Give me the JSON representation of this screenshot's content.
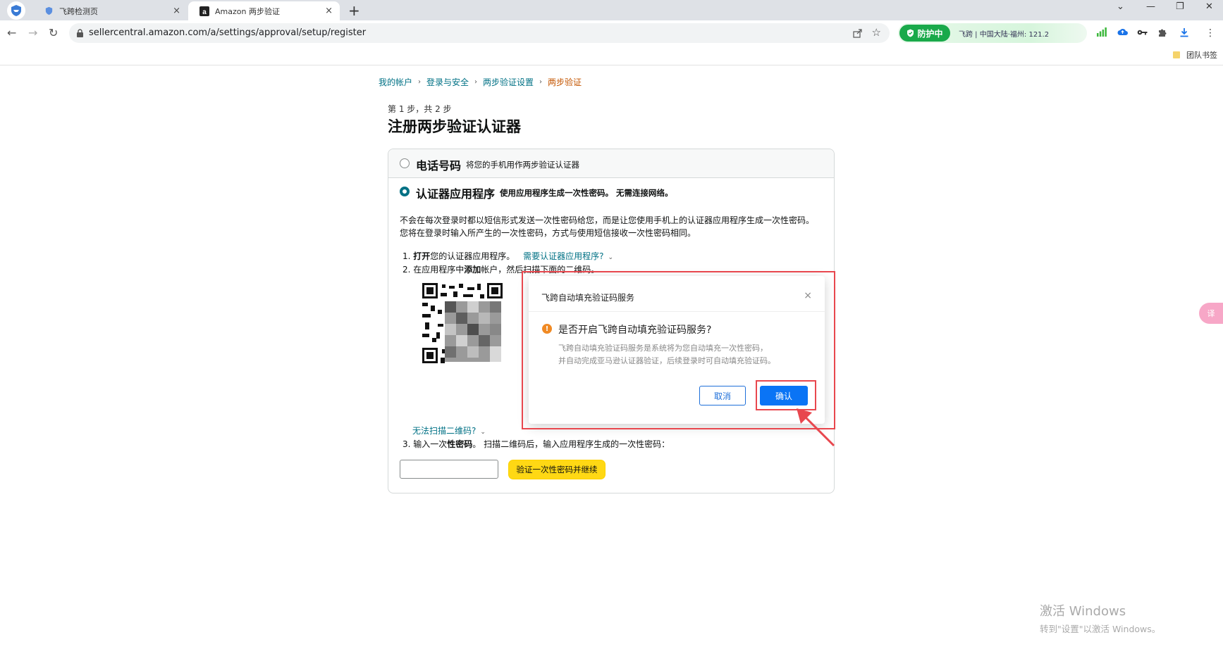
{
  "browser": {
    "tabs": [
      {
        "title": "飞跨检测页",
        "close": "×"
      },
      {
        "title": "Amazon 两步验证",
        "close": "×"
      }
    ],
    "new_tab": "+",
    "url": "sellercentral.amazon.com/a/settings/approval/setup/register",
    "extension": {
      "status": "防护中",
      "location": "飞跨 | 中国大陆·福州: 121.2"
    },
    "bookmark": "团队书签"
  },
  "breadcrumb": [
    "我的帐户",
    "登录与安全",
    "两步验证设置",
    "两步验证"
  ],
  "breadcrumb_sep": "›",
  "step_text": "第 1 步，共 2 步",
  "page_title": "注册两步验证认证器",
  "options": {
    "phone": {
      "label": "电话号码",
      "desc": "将您的手机用作两步验证认证器",
      "selected": false
    },
    "app": {
      "label": "认证器应用程序",
      "desc": "使用应用程序生成一次性密码。 无需连接网络。",
      "selected": true
    }
  },
  "explanation": "不会在每次登录时都以短信形式发送一次性密码给您，而是让您使用手机上的认证器应用程序生成一次性密码。 您将在登录时输入所产生的一次性密码，方式与使用短信接收一次性密码相同。",
  "steps": {
    "s1_prefix": "1. ",
    "s1_bold": "打开",
    "s1_rest": "您的认证器应用程序。",
    "s1_link": "需要认证器应用程序?",
    "s2_prefix": "2. 在应用程序中",
    "s2_bold": "添加",
    "s2_rest": "帐户，然后扫描下面的二维码。",
    "cant_scan": "无法扫描二维码?",
    "s3_prefix": "3. 输入一次",
    "s3_bold": "性密码",
    "s3_rest": "。 扫描二维码后，输入应用程序生成的一次性密码：",
    "verify_button": "验证一次性密码并继续"
  },
  "dialog": {
    "title": "飞跨自动填充验证码服务",
    "close": "×",
    "question": "是否开启飞跨自动填充验证码服务?",
    "desc_line1": "飞跨自动填充验证码服务是系统将为您自动填充一次性密码，",
    "desc_line2": "并自动完成亚马逊认证器验证，后续登录时可自动填充验证码。",
    "cancel": "取消",
    "confirm": "确认"
  },
  "side_float": "译",
  "watermark": {
    "line1": "激活 Windows",
    "line2": "转到\"设置\"以激活 Windows。"
  },
  "colors": {
    "link": "#007185",
    "accent_button": "#ffd814",
    "dialog_primary": "#0a74f5",
    "highlight": "#e8474e",
    "protect_green": "#19a94a"
  }
}
